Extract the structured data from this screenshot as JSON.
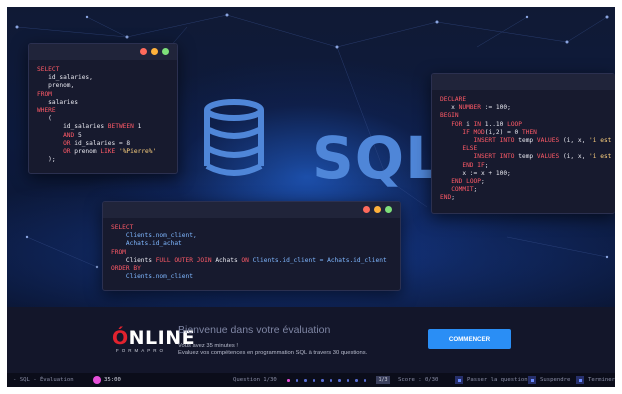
{
  "code_windows": [
    {
      "lines": [
        [
          {
            "t": "SELECT",
            "c": "kw"
          }
        ],
        [
          {
            "t": "   id_salaries,"
          }
        ],
        [
          {
            "t": "   prenom,"
          }
        ],
        [
          {
            "t": "FROM",
            "c": "kw"
          }
        ],
        [
          {
            "t": "   salaries"
          }
        ],
        [
          {
            "t": "WHERE",
            "c": "kw"
          }
        ],
        [
          {
            "t": "   ("
          }
        ],
        [
          {
            "t": "       id_salaries "
          },
          {
            "t": "BETWEEN",
            "c": "kw"
          },
          {
            "t": " 1"
          }
        ],
        [
          {
            "t": "       "
          },
          {
            "t": "AND",
            "c": "kw"
          },
          {
            "t": " 5"
          }
        ],
        [
          {
            "t": "       "
          },
          {
            "t": "OR",
            "c": "kw"
          },
          {
            "t": " id_salaries = 8"
          }
        ],
        [
          {
            "t": "       "
          },
          {
            "t": "OR",
            "c": "kw"
          },
          {
            "t": " prenom "
          },
          {
            "t": "LIKE",
            "c": "kw"
          },
          {
            "t": " "
          },
          {
            "t": "'%Pierre%'",
            "c": "str"
          }
        ],
        [
          {
            "t": "   );"
          }
        ]
      ]
    },
    {
      "lines": [
        [
          {
            "t": "DECLARE",
            "c": "kw"
          }
        ],
        [
          {
            "t": "   x "
          },
          {
            "t": "NUMBER",
            "c": "kw"
          },
          {
            "t": " := 100;"
          }
        ],
        [
          {
            "t": "BEGIN",
            "c": "kw"
          }
        ],
        [
          {
            "t": "   "
          },
          {
            "t": "FOR",
            "c": "kw"
          },
          {
            "t": " i "
          },
          {
            "t": "IN",
            "c": "kw"
          },
          {
            "t": " 1..10 "
          },
          {
            "t": "LOOP",
            "c": "kw"
          }
        ],
        [
          {
            "t": "      "
          },
          {
            "t": "IF",
            "c": "kw"
          },
          {
            "t": " "
          },
          {
            "t": "MOD",
            "c": "kw"
          },
          {
            "t": "(i,2) = 0 "
          },
          {
            "t": "THEN",
            "c": "kw"
          }
        ],
        [
          {
            "t": "         "
          },
          {
            "t": "INSERT INTO",
            "c": "kw"
          },
          {
            "t": " temp "
          },
          {
            "t": "VALUES",
            "c": "kw"
          },
          {
            "t": " (i, x, "
          },
          {
            "t": "'i est",
            "c": "str"
          }
        ],
        [
          {
            "t": "      "
          },
          {
            "t": "ELSE",
            "c": "kw"
          }
        ],
        [
          {
            "t": "         "
          },
          {
            "t": "INSERT INTO",
            "c": "kw"
          },
          {
            "t": " temp "
          },
          {
            "t": "VALUES",
            "c": "kw"
          },
          {
            "t": " (i, x, "
          },
          {
            "t": "'i est",
            "c": "str"
          }
        ],
        [
          {
            "t": "      "
          },
          {
            "t": "END IF",
            "c": "kw"
          },
          {
            "t": ";"
          }
        ],
        [
          {
            "t": "      x := x + 100;"
          }
        ],
        [
          {
            "t": "   "
          },
          {
            "t": "END LOOP",
            "c": "kw"
          },
          {
            "t": ";"
          }
        ],
        [
          {
            "t": "   "
          },
          {
            "t": "COMMIT",
            "c": "kw"
          },
          {
            "t": ";"
          }
        ],
        [
          {
            "t": "END",
            "c": "kw"
          },
          {
            "t": ";"
          }
        ]
      ]
    },
    {
      "lines": [
        [
          {
            "t": "SELECT",
            "c": "kw"
          }
        ],
        [
          {
            "t": "    Clients.nom_client,",
            "c": "id"
          }
        ],
        [
          {
            "t": "    Achats.id_achat",
            "c": "id"
          }
        ],
        [
          {
            "t": "FROM",
            "c": "kw"
          }
        ],
        [
          {
            "t": "    Clients "
          },
          {
            "t": "FULL OUTER JOIN",
            "c": "kw"
          },
          {
            "t": " Achats "
          },
          {
            "t": "ON",
            "c": "kw"
          },
          {
            "t": " Clients.id_client = Achats.id_client",
            "c": "id"
          }
        ],
        [
          {
            "t": "ORDER BY",
            "c": "kw"
          }
        ],
        [
          {
            "t": "    Clients.nom_client",
            "c": "id"
          }
        ]
      ]
    }
  ],
  "window_dot_colors": [
    "#ff6a5c",
    "#ffb13b",
    "#7ee07a"
  ],
  "hero": {
    "logo_text": "SQL"
  },
  "brand": {
    "letter": "Ó",
    "rest": "NLINE",
    "subtitle": "FORMAPRO"
  },
  "welcome": {
    "title": "Bienvenue dans votre évaluation",
    "line1": "Vous avez 35 minutes !",
    "line2": "Evaluez vos compétences en programmation SQL à travers 30 questions.",
    "start_label": "COMMENCER"
  },
  "status": {
    "exam_name": "- SQL - Évaluation",
    "timer": "35:00",
    "question_label": "Question 1/30",
    "question_dots": 10,
    "active_dot": 0,
    "page": "1/3",
    "score": "Score : 0/30",
    "skip_label": "Passer la question",
    "suspend_label": "Suspendre",
    "finish_label": "Terminer"
  },
  "colors": {
    "accent": "#2a8ef5",
    "keyword": "#ff5a67",
    "brand_red": "#e2222e",
    "timer_magenta": "#e64fd9"
  }
}
